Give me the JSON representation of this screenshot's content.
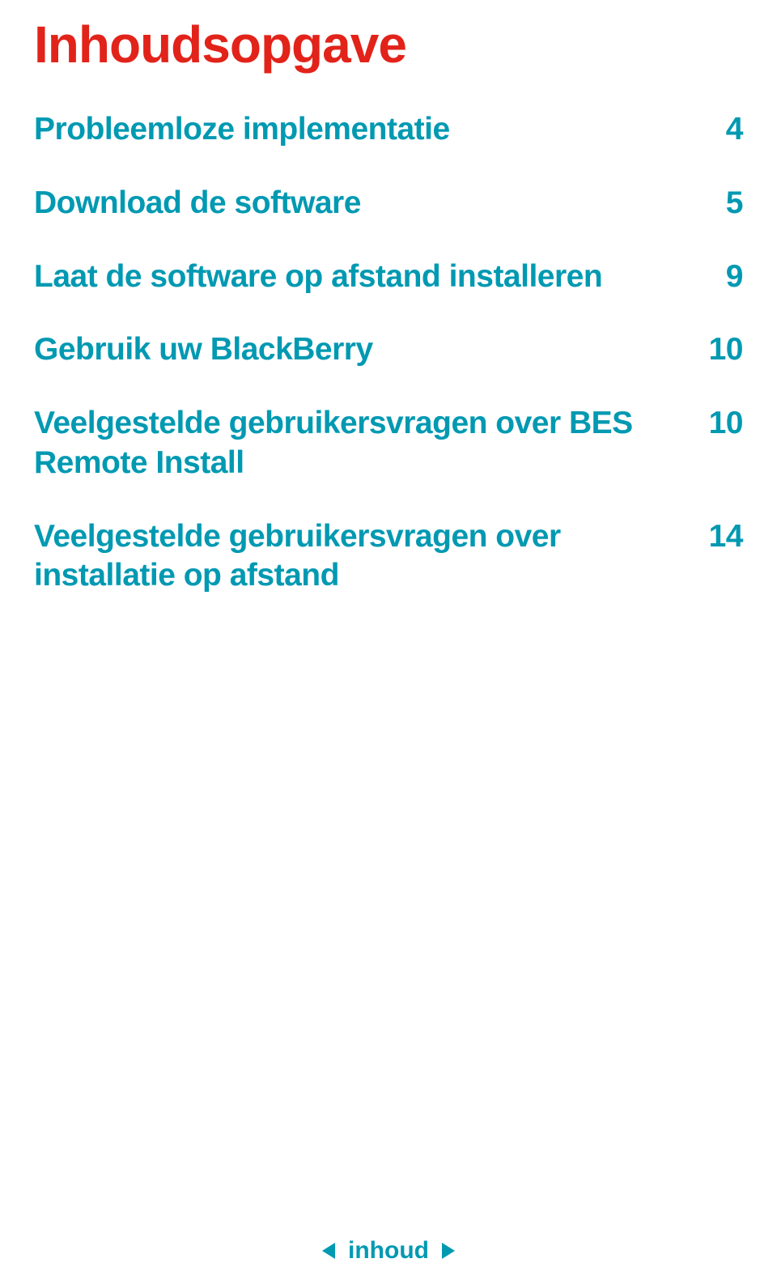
{
  "title": "Inhoudsopgave",
  "toc": [
    {
      "label": "Probleemloze implementatie",
      "page": "4"
    },
    {
      "label": "Download de software",
      "page": "5"
    },
    {
      "label": "Laat de software op afstand installeren",
      "page": "9"
    },
    {
      "label": "Gebruik uw BlackBerry",
      "page": "10"
    },
    {
      "label": "Veelgestelde gebruikersvragen over BES Remote Install",
      "page": "10"
    },
    {
      "label": "Veelgestelde gebruikersvragen over installatie op afstand",
      "page": "14"
    }
  ],
  "footer": {
    "label": "inhoud"
  },
  "colors": {
    "title": "#e2231a",
    "toc": "#0099b2",
    "footer": "#0099b2"
  }
}
